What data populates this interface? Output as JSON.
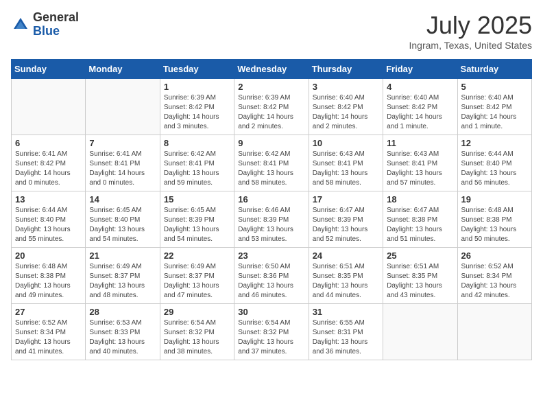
{
  "header": {
    "logo_line1": "General",
    "logo_line2": "Blue",
    "month_title": "July 2025",
    "location": "Ingram, Texas, United States"
  },
  "days_of_week": [
    "Sunday",
    "Monday",
    "Tuesday",
    "Wednesday",
    "Thursday",
    "Friday",
    "Saturday"
  ],
  "weeks": [
    [
      {
        "day": "",
        "info": ""
      },
      {
        "day": "",
        "info": ""
      },
      {
        "day": "1",
        "info": "Sunrise: 6:39 AM\nSunset: 8:42 PM\nDaylight: 14 hours and 3 minutes."
      },
      {
        "day": "2",
        "info": "Sunrise: 6:39 AM\nSunset: 8:42 PM\nDaylight: 14 hours and 2 minutes."
      },
      {
        "day": "3",
        "info": "Sunrise: 6:40 AM\nSunset: 8:42 PM\nDaylight: 14 hours and 2 minutes."
      },
      {
        "day": "4",
        "info": "Sunrise: 6:40 AM\nSunset: 8:42 PM\nDaylight: 14 hours and 1 minute."
      },
      {
        "day": "5",
        "info": "Sunrise: 6:40 AM\nSunset: 8:42 PM\nDaylight: 14 hours and 1 minute."
      }
    ],
    [
      {
        "day": "6",
        "info": "Sunrise: 6:41 AM\nSunset: 8:42 PM\nDaylight: 14 hours and 0 minutes."
      },
      {
        "day": "7",
        "info": "Sunrise: 6:41 AM\nSunset: 8:41 PM\nDaylight: 14 hours and 0 minutes."
      },
      {
        "day": "8",
        "info": "Sunrise: 6:42 AM\nSunset: 8:41 PM\nDaylight: 13 hours and 59 minutes."
      },
      {
        "day": "9",
        "info": "Sunrise: 6:42 AM\nSunset: 8:41 PM\nDaylight: 13 hours and 58 minutes."
      },
      {
        "day": "10",
        "info": "Sunrise: 6:43 AM\nSunset: 8:41 PM\nDaylight: 13 hours and 58 minutes."
      },
      {
        "day": "11",
        "info": "Sunrise: 6:43 AM\nSunset: 8:41 PM\nDaylight: 13 hours and 57 minutes."
      },
      {
        "day": "12",
        "info": "Sunrise: 6:44 AM\nSunset: 8:40 PM\nDaylight: 13 hours and 56 minutes."
      }
    ],
    [
      {
        "day": "13",
        "info": "Sunrise: 6:44 AM\nSunset: 8:40 PM\nDaylight: 13 hours and 55 minutes."
      },
      {
        "day": "14",
        "info": "Sunrise: 6:45 AM\nSunset: 8:40 PM\nDaylight: 13 hours and 54 minutes."
      },
      {
        "day": "15",
        "info": "Sunrise: 6:45 AM\nSunset: 8:39 PM\nDaylight: 13 hours and 54 minutes."
      },
      {
        "day": "16",
        "info": "Sunrise: 6:46 AM\nSunset: 8:39 PM\nDaylight: 13 hours and 53 minutes."
      },
      {
        "day": "17",
        "info": "Sunrise: 6:47 AM\nSunset: 8:39 PM\nDaylight: 13 hours and 52 minutes."
      },
      {
        "day": "18",
        "info": "Sunrise: 6:47 AM\nSunset: 8:38 PM\nDaylight: 13 hours and 51 minutes."
      },
      {
        "day": "19",
        "info": "Sunrise: 6:48 AM\nSunset: 8:38 PM\nDaylight: 13 hours and 50 minutes."
      }
    ],
    [
      {
        "day": "20",
        "info": "Sunrise: 6:48 AM\nSunset: 8:38 PM\nDaylight: 13 hours and 49 minutes."
      },
      {
        "day": "21",
        "info": "Sunrise: 6:49 AM\nSunset: 8:37 PM\nDaylight: 13 hours and 48 minutes."
      },
      {
        "day": "22",
        "info": "Sunrise: 6:49 AM\nSunset: 8:37 PM\nDaylight: 13 hours and 47 minutes."
      },
      {
        "day": "23",
        "info": "Sunrise: 6:50 AM\nSunset: 8:36 PM\nDaylight: 13 hours and 46 minutes."
      },
      {
        "day": "24",
        "info": "Sunrise: 6:51 AM\nSunset: 8:35 PM\nDaylight: 13 hours and 44 minutes."
      },
      {
        "day": "25",
        "info": "Sunrise: 6:51 AM\nSunset: 8:35 PM\nDaylight: 13 hours and 43 minutes."
      },
      {
        "day": "26",
        "info": "Sunrise: 6:52 AM\nSunset: 8:34 PM\nDaylight: 13 hours and 42 minutes."
      }
    ],
    [
      {
        "day": "27",
        "info": "Sunrise: 6:52 AM\nSunset: 8:34 PM\nDaylight: 13 hours and 41 minutes."
      },
      {
        "day": "28",
        "info": "Sunrise: 6:53 AM\nSunset: 8:33 PM\nDaylight: 13 hours and 40 minutes."
      },
      {
        "day": "29",
        "info": "Sunrise: 6:54 AM\nSunset: 8:32 PM\nDaylight: 13 hours and 38 minutes."
      },
      {
        "day": "30",
        "info": "Sunrise: 6:54 AM\nSunset: 8:32 PM\nDaylight: 13 hours and 37 minutes."
      },
      {
        "day": "31",
        "info": "Sunrise: 6:55 AM\nSunset: 8:31 PM\nDaylight: 13 hours and 36 minutes."
      },
      {
        "day": "",
        "info": ""
      },
      {
        "day": "",
        "info": ""
      }
    ]
  ]
}
